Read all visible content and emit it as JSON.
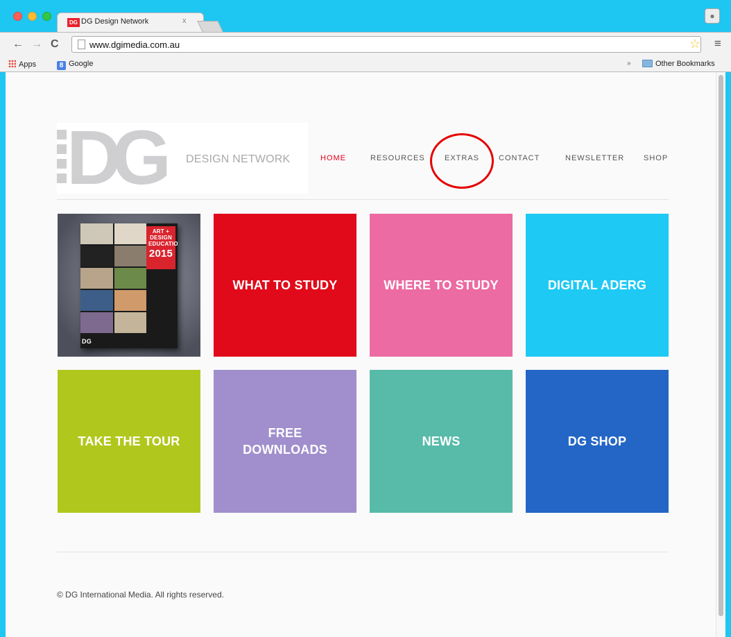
{
  "browser": {
    "tab_title": "DG Design Network",
    "tab_favicon": "DG",
    "tab_close": "x",
    "url": "www.dgimedia.com.au",
    "bookmarks": [
      {
        "label": "Apps",
        "icon": "apps-grid-icon"
      },
      {
        "label": "Google",
        "icon": "google-icon"
      }
    ],
    "other_bookmarks": "Other Bookmarks",
    "overflow": "»",
    "back_icon": "←",
    "forward_icon": "→",
    "reload_icon": "C",
    "star_icon": "☆",
    "menu_icon": "≡",
    "profile_icon": "👤"
  },
  "site": {
    "logo": {
      "letters": "DG",
      "text": "DESIGN NETWORK"
    },
    "nav": [
      {
        "label": "HOME",
        "active": true
      },
      {
        "label": "RESOURCES",
        "active": false
      },
      {
        "label": "EXTRAS",
        "active": false
      },
      {
        "label": "CONTACT",
        "active": false
      },
      {
        "label": "NEWSLETTER",
        "active": false
      },
      {
        "label": "SHOP",
        "active": false
      }
    ],
    "tiles": [
      {
        "label": "",
        "color": "cover-image"
      },
      {
        "label": "WHAT TO STUDY",
        "color": "#e10a1a"
      },
      {
        "label": "WHERE TO STUDY",
        "color": "#ec6ba3"
      },
      {
        "label": "DIGITAL ADERG",
        "color": "#1ec9f4"
      },
      {
        "label": "TAKE THE TOUR",
        "color": "#b0c81d"
      },
      {
        "label_line1": "FREE",
        "label_line2": "DOWNLOADS",
        "color": "#a08fcc"
      },
      {
        "label": "NEWS",
        "color": "#58bba9"
      },
      {
        "label": "DG SHOP",
        "color": "#2366c6"
      }
    ],
    "magazine": {
      "heading": "ART + DESIGN EDUCATION",
      "year": "2015",
      "brand": "DG"
    },
    "footer": "© DG International Media. All rights reserved."
  },
  "colors": {
    "frame": "#1ec6f2",
    "nav_active": "#e2001a",
    "annotation_circle": "#e40000"
  }
}
